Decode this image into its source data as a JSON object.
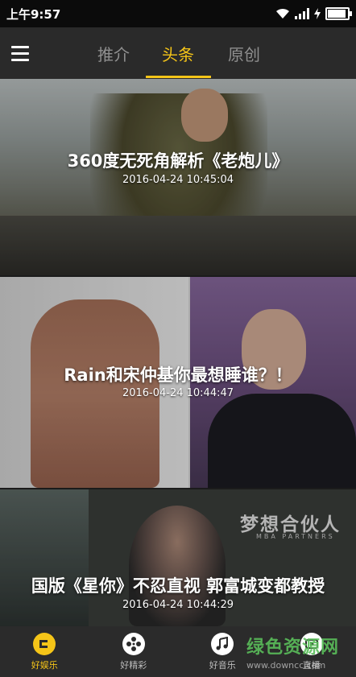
{
  "status_bar": {
    "time": "上午9:57",
    "battery_level": 0.85
  },
  "header": {
    "menu_icon": "hamburger-icon",
    "tabs": [
      {
        "label": "推介",
        "active": false
      },
      {
        "label": "头条",
        "active": true
      },
      {
        "label": "原创",
        "active": false
      }
    ],
    "accent_color": "#f5c518"
  },
  "feed": [
    {
      "title": "360度无死角解析《老炮儿》",
      "date": "2016-04-24 10:45:04"
    },
    {
      "title": "Rain和宋仲基你最想睡谁？！",
      "date": "2016-04-24 10:44:47"
    },
    {
      "title": "国版《星你》不忍直视 郭富城变都教授",
      "date": "2016-04-24 10:44:29",
      "image_brand": "梦想合伙人",
      "image_brand_sub": "MBA PARTNERS"
    }
  ],
  "bottom_nav": [
    {
      "label": "好娱乐",
      "icon": "chat-bubble-icon",
      "active": true
    },
    {
      "label": "好精彩",
      "icon": "film-reel-icon",
      "active": false
    },
    {
      "label": "好音乐",
      "icon": "music-note-icon",
      "active": false
    },
    {
      "label": "直播",
      "icon": "live-tv-icon",
      "active": false
    }
  ],
  "watermark": {
    "main": "绿色资源网",
    "sub": "www.downcc.com"
  }
}
